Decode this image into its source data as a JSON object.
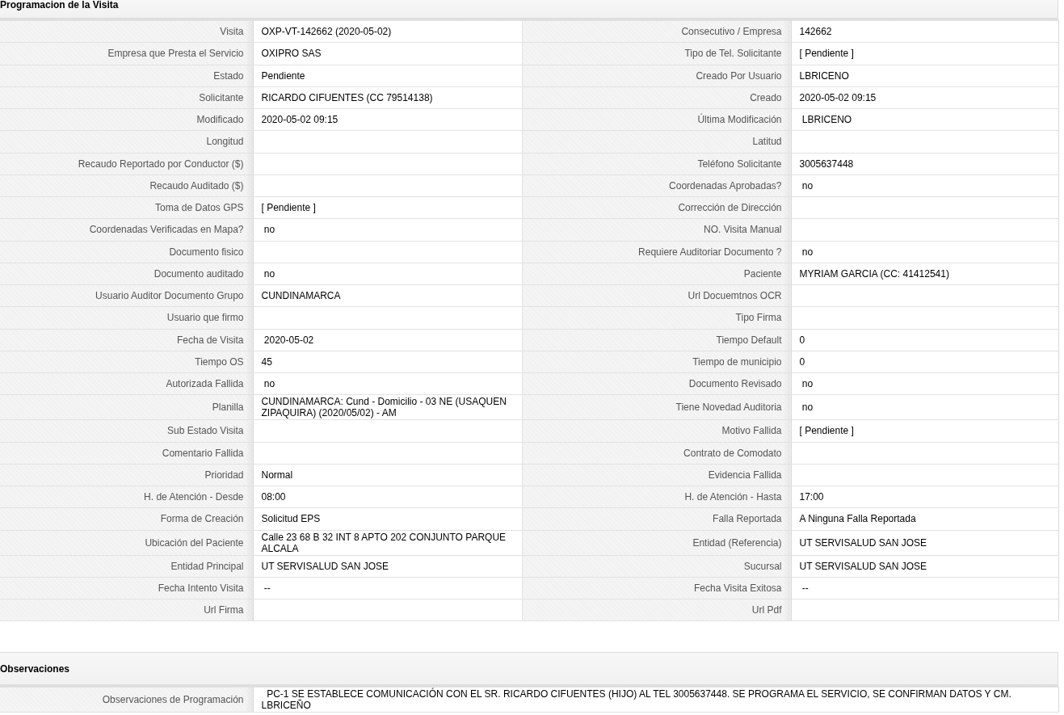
{
  "visit_schedule": {
    "title": "Programacion de la Visita",
    "rows": [
      {
        "left": {
          "label": "Visita",
          "value": "OXP-VT-142662 (2020-05-02)"
        },
        "right": {
          "label": "Consecutivo / Empresa",
          "value": "142662"
        }
      },
      {
        "left": {
          "label": "Empresa que Presta el Servicio",
          "value": "OXIPRO SAS"
        },
        "right": {
          "label": "Tipo de Tel. Solicitante",
          "value": "[ Pendiente ]"
        }
      },
      {
        "left": {
          "label": "Estado",
          "value": "Pendiente"
        },
        "right": {
          "label": "Creado Por Usuario",
          "value": "LBRICENO"
        }
      },
      {
        "left": {
          "label": "Solicitante",
          "value": "RICARDO CIFUENTES (CC 79514138)"
        },
        "right": {
          "label": "Creado",
          "value": "2020-05-02 09:15"
        }
      },
      {
        "left": {
          "label": "Modificado",
          "value": "2020-05-02 09:15"
        },
        "right": {
          "label": "Última Modificación",
          "value": " LBRICENO"
        }
      },
      {
        "left": {
          "label": "Longitud"
        },
        "right": {
          "label": "Latitud"
        }
      },
      {
        "left": {
          "label": "Recaudo Reportado por Conductor ($)"
        },
        "right": {
          "label": "Teléfono Solicitante",
          "value": "3005637448"
        }
      },
      {
        "left": {
          "label": "Recaudo Auditado ($)"
        },
        "right": {
          "label": "Coordenadas Aprobadas?",
          "value": " no"
        }
      },
      {
        "left": {
          "label": "Toma de Datos GPS",
          "value": "[ Pendiente ]"
        },
        "right": {
          "label": "Corrección de Dirección"
        }
      },
      {
        "left": {
          "label": "Coordenadas Verificadas en Mapa?",
          "value": " no"
        },
        "right": {
          "label": "NO. Visita Manual"
        }
      },
      {
        "left": {
          "label": "Documento fisico"
        },
        "right": {
          "label": "Requiere Auditoriar Documento ?",
          "value": " no"
        }
      },
      {
        "left": {
          "label": "Documento auditado",
          "value": " no"
        },
        "right": {
          "label": "Paciente",
          "value": "MYRIAM GARCIA (CC: 41412541)"
        }
      },
      {
        "left": {
          "label": "Usuario Auditor Documento Grupo",
          "value": "CUNDINAMARCA"
        },
        "right": {
          "label": "Url Docuemtnos OCR"
        }
      },
      {
        "left": {
          "label": "Usuario que firmo"
        },
        "right": {
          "label": "Tipo Firma"
        }
      },
      {
        "left": {
          "label": "Fecha de Visita",
          "value": " 2020-05-02"
        },
        "right": {
          "label": "Tiempo Default",
          "value": "0"
        }
      },
      {
        "left": {
          "label": "Tiempo OS",
          "value": "45"
        },
        "right": {
          "label": "Tiempo de municipio",
          "value": "0"
        }
      },
      {
        "left": {
          "label": "Autorizada Fallida",
          "value": " no"
        },
        "right": {
          "label": "Documento Revisado",
          "value": " no"
        }
      },
      {
        "left": {
          "label": "Planilla",
          "value": "CUNDINAMARCA: Cund - Domicilio - 03 NE (USAQUEN ZIPAQUIRA) (2020/05/02) - AM"
        },
        "right": {
          "label": "Tiene Novedad Auditoria",
          "value": " no"
        }
      },
      {
        "left": {
          "label": "Sub Estado Visita"
        },
        "right": {
          "label": "Motivo Fallida",
          "value": "[ Pendiente ]"
        }
      },
      {
        "left": {
          "label": "Comentario Fallida"
        },
        "right": {
          "label": "Contrato de Comodato"
        }
      },
      {
        "left": {
          "label": "Prioridad",
          "value": "Normal"
        },
        "right": {
          "label": "Evidencia Fallida"
        }
      },
      {
        "left": {
          "label": "H. de Atención - Desde",
          "value": "08:00"
        },
        "right": {
          "label": "H. de Atención - Hasta",
          "value": "17:00"
        }
      },
      {
        "left": {
          "label": "Forma de Creación",
          "value": "Solicitud EPS"
        },
        "right": {
          "label": "Falla Reportada",
          "value": "A Ninguna Falla Reportada"
        }
      },
      {
        "left": {
          "label": "Ubicación del Paciente",
          "value": "Calle 23 68 B 32 INT 8 APTO 202 CONJUNTO PARQUE ALCALA"
        },
        "right": {
          "label": "Entidad (Referencia)",
          "value": "UT SERVISALUD SAN JOSE"
        }
      },
      {
        "left": {
          "label": "Entidad Principal",
          "value": "UT SERVISALUD SAN JOSE"
        },
        "right": {
          "label": "Sucursal",
          "value": "UT SERVISALUD SAN JOSE"
        }
      },
      {
        "left": {
          "label": "Fecha Intento Visita",
          "value": " --"
        },
        "right": {
          "label": "Fecha Visita Exitosa",
          "value": " --"
        }
      },
      {
        "left": {
          "label": "Url Firma"
        },
        "right": {
          "label": "Url Pdf"
        }
      }
    ]
  },
  "observations": {
    "title": "Observaciones",
    "rows": [
      {
        "label": "Observaciones de Programación",
        "value": "  PC-1 SE ESTABLECE COMUNICACIÓN CON EL SR. RICARDO CIFUENTES (HIJO) AL TEL 3005637448. SE PROGRAMA EL SERVICIO, SE CONFIRMAN DATOS Y CM.\nLBRICEÑO"
      }
    ]
  }
}
